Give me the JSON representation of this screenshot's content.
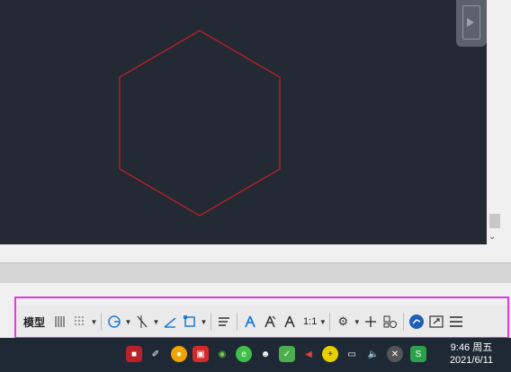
{
  "statusbar": {
    "model_label": "模型",
    "scale_label": "1:1"
  },
  "taskbar": {
    "time": "9:46 周五",
    "date": "2021/6/11"
  },
  "colors": {
    "canvas_bg": "#242a33",
    "hexagon_stroke": "#c81e24",
    "highlight": "#e03be0",
    "taskbar_bg": "#1f2936"
  },
  "icons": [
    "grid-icon",
    "snap-icon",
    "dropdown-icon",
    "polar-tracking-icon",
    "ortho-icon",
    "isodraft-icon",
    "object-snap-icon",
    "lineweight-icon",
    "annotation-visibility-icon",
    "auto-scale-icon",
    "annotation-scale-icon",
    "workspace-gear-icon",
    "plus-icon",
    "isolate-objects-icon",
    "hardware-acceleration-icon",
    "clean-screen-icon",
    "customization-menu-icon"
  ]
}
